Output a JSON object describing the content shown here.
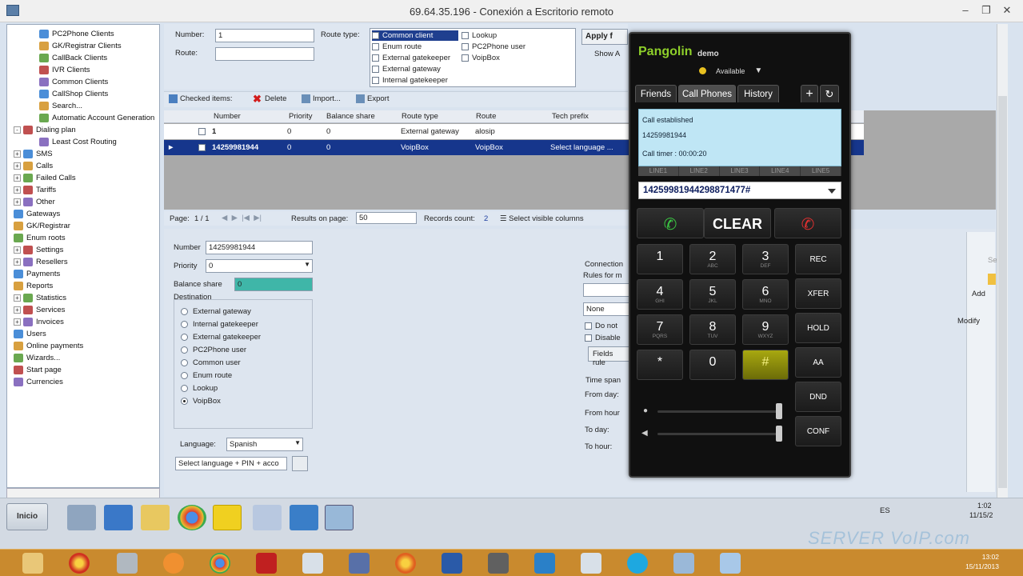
{
  "window": {
    "title": "69.64.35.196 - Conexión a Escritorio remoto"
  },
  "tree": {
    "items": [
      {
        "label": "PC2Phone Clients",
        "indent": 3
      },
      {
        "label": "GK/Registrar Clients",
        "indent": 3
      },
      {
        "label": "CallBack Clients",
        "indent": 3
      },
      {
        "label": "IVR Clients",
        "indent": 3
      },
      {
        "label": "Common Clients",
        "indent": 3
      },
      {
        "label": "CallShop Clients",
        "indent": 3
      },
      {
        "label": "Search...",
        "indent": 3
      },
      {
        "label": "Automatic Account Generation",
        "indent": 3
      },
      {
        "label": "Dialing plan",
        "indent": 1,
        "expander": "-"
      },
      {
        "label": "Least Cost Routing",
        "indent": 3
      },
      {
        "label": "SMS",
        "indent": 1,
        "expander": "+"
      },
      {
        "label": "Calls",
        "indent": 1,
        "expander": "+"
      },
      {
        "label": "Failed Calls",
        "indent": 1,
        "expander": "+"
      },
      {
        "label": "Tariffs",
        "indent": 1,
        "expander": "+"
      },
      {
        "label": "Other",
        "indent": 1,
        "expander": "+"
      },
      {
        "label": "Gateways",
        "indent": 1
      },
      {
        "label": "GK/Registrar",
        "indent": 1
      },
      {
        "label": "Enum roots",
        "indent": 1
      },
      {
        "label": "Settings",
        "indent": 1,
        "expander": "+"
      },
      {
        "label": "Resellers",
        "indent": 1,
        "expander": "+"
      },
      {
        "label": "Payments",
        "indent": 1
      },
      {
        "label": "Reports",
        "indent": 1
      },
      {
        "label": "Statistics",
        "indent": 1,
        "expander": "+"
      },
      {
        "label": "Services",
        "indent": 1,
        "expander": "+"
      },
      {
        "label": "Invoices",
        "indent": 1,
        "expander": "+"
      },
      {
        "label": "Users",
        "indent": 1
      },
      {
        "label": "Online payments",
        "indent": 1
      },
      {
        "label": "Wizards...",
        "indent": 1
      },
      {
        "label": "Start page",
        "indent": 1
      },
      {
        "label": "Currencies",
        "indent": 1
      }
    ]
  },
  "filter": {
    "number_label": "Number:",
    "number_value": "1",
    "route_label": "Route:",
    "route_value": "",
    "route_type_label": "Route type:",
    "route_types_col1": [
      "Common client",
      "Enum route",
      "External gatekeeper",
      "External gateway",
      "Internal gatekeeper"
    ],
    "route_types_col2": [
      "Lookup",
      "PC2Phone user",
      "VoipBox"
    ],
    "apply_label": "Apply f",
    "show_label": "Show A"
  },
  "toolbar": {
    "checked_items": "Checked items:",
    "delete": "Delete",
    "import": "Import...",
    "export": "Export"
  },
  "grid": {
    "headers": [
      "Number",
      "Priority",
      "Balance share",
      "Route type",
      "Route",
      "Tech prefix"
    ],
    "rows": [
      {
        "number": "1",
        "priority": "0",
        "balance": "0",
        "route_type": "External gateway",
        "route": "alosip",
        "tech": ""
      },
      {
        "number": "14259981944",
        "priority": "0",
        "balance": "0",
        "route_type": "VoipBox",
        "route": "VoipBox",
        "tech": "Select language ..."
      }
    ]
  },
  "pager": {
    "page_label": "Page:",
    "page_value": "1 / 1",
    "results_label": "Results on page:",
    "results_value": "50",
    "records_label": "Records count:",
    "records_value": "2",
    "select_cols": "Select visible columns"
  },
  "detail": {
    "number_label": "Number",
    "number_value": "14259981944",
    "priority_label": "Priority",
    "priority_value": "0",
    "balance_label": "Balance share",
    "balance_value": "0",
    "destination_label": "Destination",
    "destinations": [
      "External gateway",
      "Internal gatekeeper",
      "External gatekeeper",
      "PC2Phone user",
      "Common user",
      "Enum route",
      "Lookup",
      "VoipBox"
    ],
    "selected_destination": "VoipBox",
    "language_label": "Language:",
    "language_value": "Spanish",
    "select_language_value": "Select language + PIN + acco",
    "connection_label": "Connection",
    "rules_label": "Rules for m",
    "none_value": "None",
    "do_not_label": "Do not",
    "disable_label": "Disable",
    "fields_rule_label": "Fields rule",
    "time_span_label": "Time span",
    "from_day_label": "From day:",
    "from_hour_label": "From hour",
    "to_day_label": "To day:",
    "to_hour_label": "To hour:"
  },
  "right_panel": {
    "add_label": "Add",
    "modify_label": "Modify",
    "se_label": "Se"
  },
  "remote_taskbar": {
    "start_label": "Inicio",
    "lang": "ES",
    "time": "1:02",
    "date": "11/15/2"
  },
  "phone": {
    "brand": "Pangolin",
    "brand_suffix": "demo",
    "status": "Available",
    "tabs": [
      "Friends",
      "Call Phones",
      "History"
    ],
    "active_tab": "Call Phones",
    "call_status": "Call established",
    "call_number": "14259981944",
    "call_timer": "Call timer : 00:00:20",
    "lines": [
      "LINE1",
      "LINE2",
      "LINE3",
      "LINE4",
      "LINE5"
    ],
    "dial_value": "14259981944298871477#",
    "clear_label": "CLEAR",
    "keys": [
      {
        "n": "1",
        "s": ""
      },
      {
        "n": "2",
        "s": "ABC"
      },
      {
        "n": "3",
        "s": "DEF"
      },
      {
        "n": "4",
        "s": "GHI"
      },
      {
        "n": "5",
        "s": "JKL"
      },
      {
        "n": "6",
        "s": "MNO"
      },
      {
        "n": "7",
        "s": "PQRS"
      },
      {
        "n": "8",
        "s": "TUV"
      },
      {
        "n": "9",
        "s": "WXYZ"
      },
      {
        "n": "*",
        "s": ""
      },
      {
        "n": "0",
        "s": ""
      },
      {
        "n": "#",
        "s": ""
      }
    ],
    "fn_keys": [
      "REC",
      "XFER",
      "HOLD",
      "AA",
      "DND",
      "CONF"
    ],
    "accent": "#8ecf2a"
  },
  "win_taskbar": {
    "time": "13:02",
    "date": "15/11/2013"
  },
  "watermark": "SERVER VoIP.com"
}
